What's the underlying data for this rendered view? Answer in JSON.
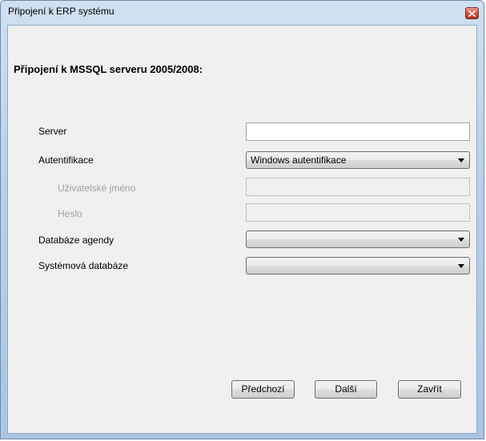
{
  "window": {
    "title": "Připojení k ERP systému"
  },
  "form": {
    "heading": "Připojení k MSSQL serveru 2005/2008:",
    "server_label": "Server",
    "server_value": "",
    "auth_label": "Autentifikace",
    "auth_value": "Windows autentifikace",
    "username_label": "Uživatelské jméno",
    "username_value": "",
    "password_label": "Heslo",
    "password_value": "",
    "agenda_db_label": "Databáze agendy",
    "agenda_db_value": "",
    "system_db_label": "Systémová databáze",
    "system_db_value": ""
  },
  "buttons": {
    "previous": "Předchozí",
    "next": "Další",
    "close": "Zavřít"
  },
  "icons": {
    "close": "close-icon",
    "dropdown": "chevron-down-icon"
  },
  "colors": {
    "title_gradient_top": "#cfe0f1",
    "close_button": "#d3513c",
    "client_background": "#f0f0f0",
    "disabled_text": "#a0a0a0"
  }
}
